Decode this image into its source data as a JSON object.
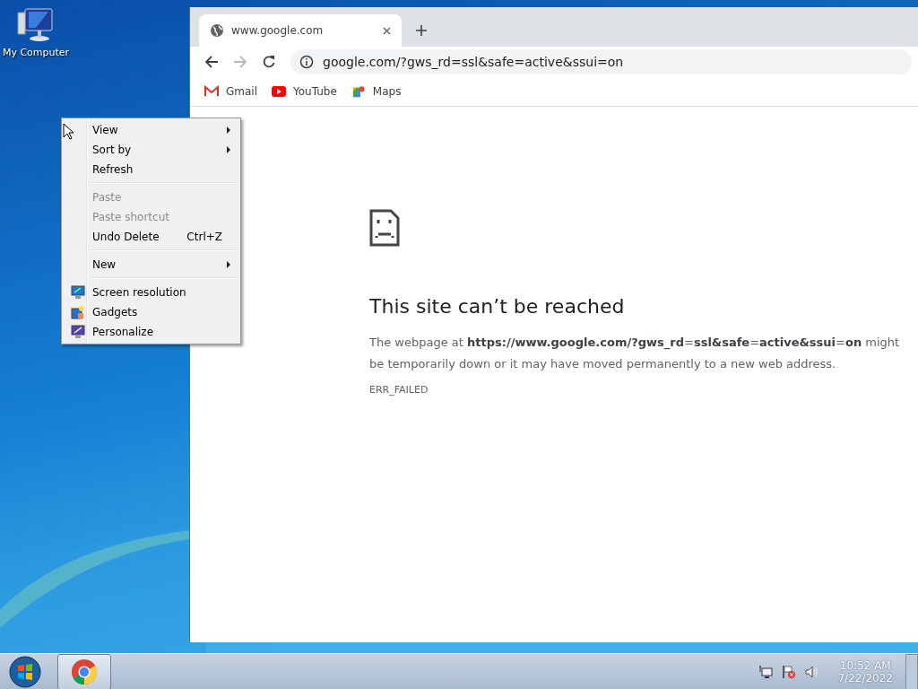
{
  "desktop": {
    "icons": [
      {
        "label": "My Computer"
      }
    ]
  },
  "browser": {
    "tabs": [
      {
        "title": "www.google.com",
        "selected": true
      }
    ],
    "address": "google.com/?gws_rd=ssl&safe=active&ssui=on",
    "bookmarks": [
      {
        "kind": "gmail",
        "label": "Gmail"
      },
      {
        "kind": "youtube",
        "label": "YouTube"
      },
      {
        "kind": "maps",
        "label": "Maps"
      }
    ],
    "error": {
      "title": "This site can’t be reached",
      "message": "The webpage at **https://www.google.com/?gws_rd**=**ssl&safe**=**active&ssui**=**on** might be temporarily down or it may have moved permanently to a new web address.",
      "code": "ERR_FAILED"
    }
  },
  "context_menu": {
    "items": [
      {
        "kind": "item",
        "label": "View",
        "submenu": true,
        "disabled": false
      },
      {
        "kind": "item",
        "label": "Sort by",
        "submenu": true,
        "disabled": false
      },
      {
        "kind": "item",
        "label": "Refresh",
        "submenu": false,
        "disabled": false
      },
      {
        "kind": "separator"
      },
      {
        "kind": "item",
        "label": "Paste",
        "submenu": false,
        "disabled": true
      },
      {
        "kind": "item",
        "label": "Paste shortcut",
        "submenu": false,
        "disabled": true
      },
      {
        "kind": "item",
        "label": "Undo Delete",
        "shortcut": "Ctrl+Z",
        "submenu": false,
        "disabled": false
      },
      {
        "kind": "separator"
      },
      {
        "kind": "item",
        "label": "New",
        "submenu": true,
        "disabled": false
      },
      {
        "kind": "separator"
      },
      {
        "kind": "screen",
        "label": "Screen resolution",
        "submenu": false,
        "disabled": false
      },
      {
        "kind": "gadgets",
        "label": "Gadgets",
        "submenu": false,
        "disabled": false
      },
      {
        "kind": "personalize",
        "label": "Personalize",
        "submenu": false,
        "disabled": false
      }
    ]
  },
  "taskbar": {
    "time": "10:52 AM",
    "date": "7/22/2022"
  }
}
